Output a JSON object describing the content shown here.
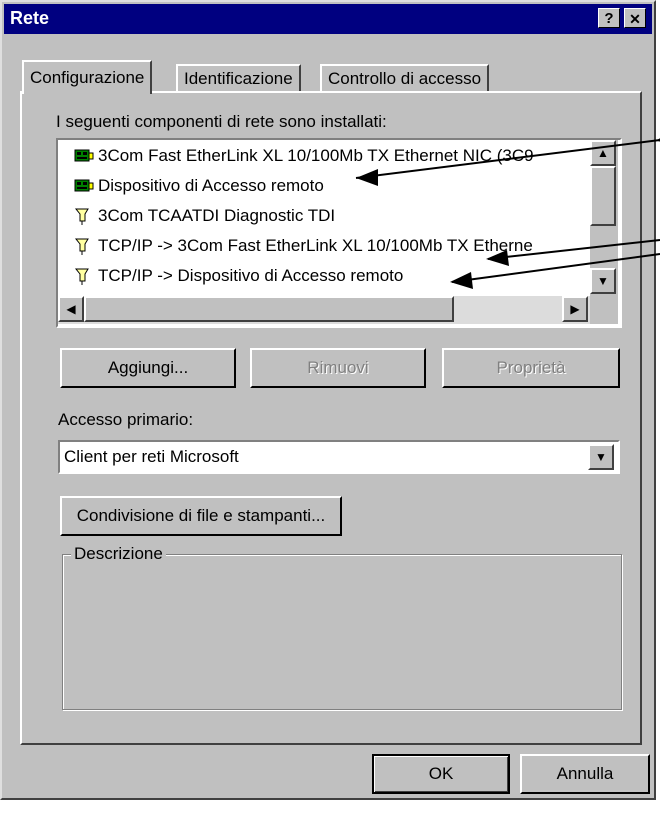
{
  "window": {
    "title": "Rete",
    "help_button": "?",
    "close_button": "✕"
  },
  "tabs": [
    {
      "label": "Configurazione",
      "active": true
    },
    {
      "label": "Identificazione",
      "active": false
    },
    {
      "label": "Controllo di accesso",
      "active": false
    }
  ],
  "components": {
    "label": "I seguenti componenti di rete sono installati:",
    "items": [
      {
        "label": "3Com Fast EtherLink XL 10/100Mb TX Ethernet NIC (3C9",
        "icon": "network-adapter-icon"
      },
      {
        "label": "Dispositivo di Accesso remoto",
        "icon": "network-adapter-icon"
      },
      {
        "label": "3Com TCAATDI Diagnostic TDI",
        "icon": "protocol-icon"
      },
      {
        "label": "TCP/IP -> 3Com Fast EtherLink XL 10/100Mb TX Etherne",
        "icon": "protocol-icon"
      },
      {
        "label": "TCP/IP -> Dispositivo di Accesso remoto",
        "icon": "protocol-icon"
      }
    ]
  },
  "buttons": {
    "add": "Aggiungi...",
    "remove": "Rimuovi",
    "properties": "Proprietà",
    "sharing": "Condivisione di file e stampanti...",
    "ok": "OK",
    "cancel": "Annulla"
  },
  "primary_logon": {
    "label": "Accesso primario:",
    "value": "Client per reti Microsoft"
  },
  "description": {
    "label": "Descrizione"
  },
  "colors": {
    "titlebar": "#000080",
    "face": "#c0c0c0",
    "window": "#ffffff"
  }
}
